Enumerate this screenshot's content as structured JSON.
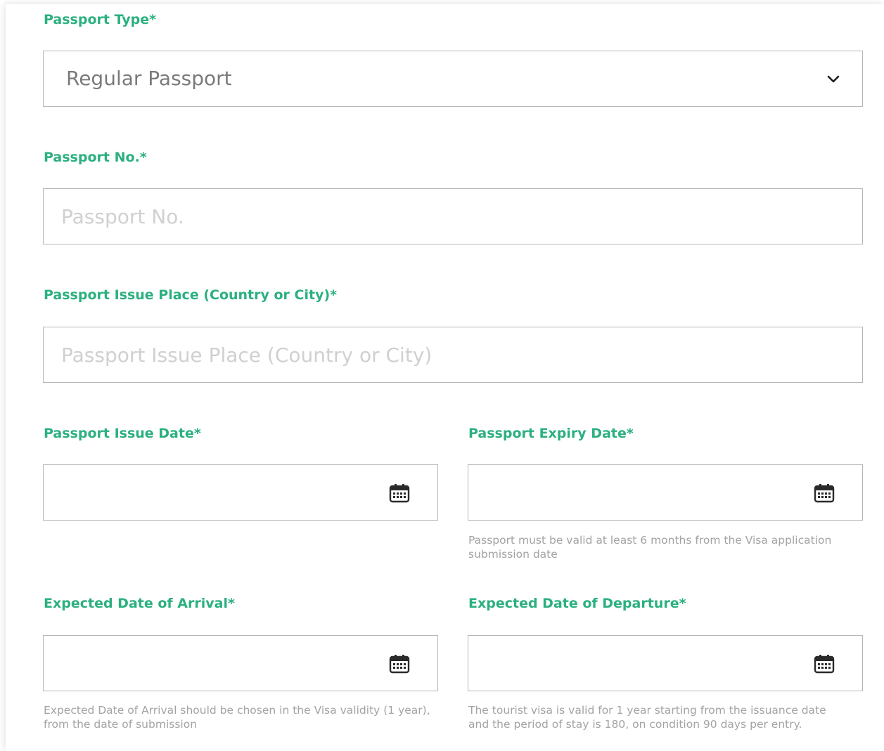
{
  "passport_type": {
    "label": "Passport Type*",
    "selected": "Regular Passport"
  },
  "passport_no": {
    "label": "Passport No.*",
    "value": "",
    "placeholder": "Passport No."
  },
  "passport_issue_place": {
    "label": "Passport Issue Place (Country or City)*",
    "value": "",
    "placeholder": "Passport Issue Place (Country or City)"
  },
  "passport_issue_date": {
    "label": "Passport Issue Date*",
    "value": ""
  },
  "passport_expiry_date": {
    "label": "Passport Expiry Date*",
    "value": "",
    "hint": "Passport must be valid at least 6 months from the Visa application submission date"
  },
  "expected_arrival": {
    "label": "Expected Date of Arrival*",
    "value": "",
    "hint": "Expected Date of Arrival should be chosen in the Visa validity (1 year), from the date of submission"
  },
  "expected_departure": {
    "label": "Expected Date of Departure*",
    "value": "",
    "hint": "The tourist visa is valid for 1 year starting from the issuance date and the period of stay is 180, on condition 90 days per entry."
  },
  "colors": {
    "label": "#2bb07f",
    "border": "#b6b6b6",
    "placeholder": "#d0d0d0",
    "hint": "#a3a3a3"
  },
  "icons": {
    "select": "chevron-down-icon",
    "date": "calendar-icon"
  }
}
